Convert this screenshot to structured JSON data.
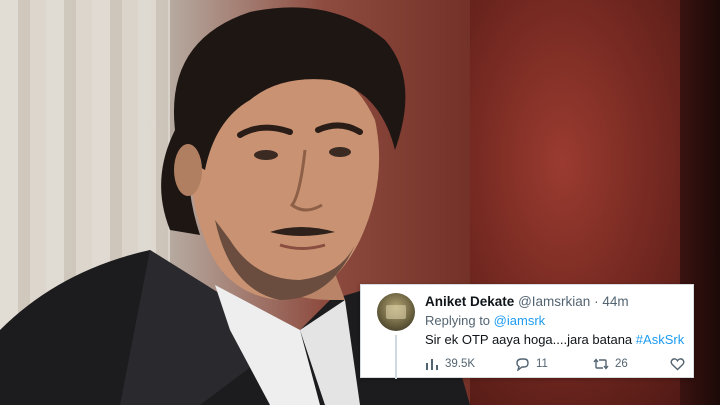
{
  "tweet": {
    "author_name": "Aniket Dekate",
    "author_handle": "@Iamsrkian",
    "separator": "·",
    "time_ago": "44m",
    "replying_prefix": "Replying to",
    "replying_to": "@iamsrk",
    "body_text": "Sir ek OTP aaya hoga....jara batana",
    "hashtag": "#AskSrk",
    "views": "39.5K",
    "replies": "11",
    "retweets": "26",
    "likes": ""
  },
  "icons": {
    "views": "bar-chart-icon",
    "reply": "speech-bubble-icon",
    "retweet": "retweet-icon",
    "like": "heart-icon"
  },
  "colors": {
    "link": "#1d9bf0",
    "text_primary": "#0f1419",
    "text_secondary": "#536471"
  }
}
